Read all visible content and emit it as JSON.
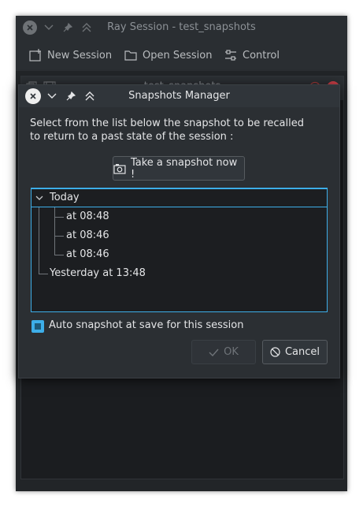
{
  "main_window": {
    "title": "Ray Session - test_snapshots",
    "toolbar": {
      "new_session": "New Session",
      "open_session": "Open Session",
      "control": "Control"
    },
    "session_header": "test_snapshots"
  },
  "dialog": {
    "title": "Snapshots Manager",
    "intro_line1": "Select from the list below the snapshot to be recalled",
    "intro_line2": "to return to a past state of the session :",
    "take_snapshot_label": "Take a snapshot now !",
    "tree": {
      "group_today": "Today",
      "today_items": [
        "at 08:48",
        "at 08:46",
        "at 08:46"
      ],
      "yesterday": "Yesterday at 13:48"
    },
    "auto_snapshot_label": "Auto snapshot at save for this session",
    "auto_snapshot_checked": true,
    "ok_label": "OK",
    "cancel_label": "Cancel"
  },
  "colors": {
    "accent": "#3daee9",
    "window_bg": "#2b2f33"
  }
}
